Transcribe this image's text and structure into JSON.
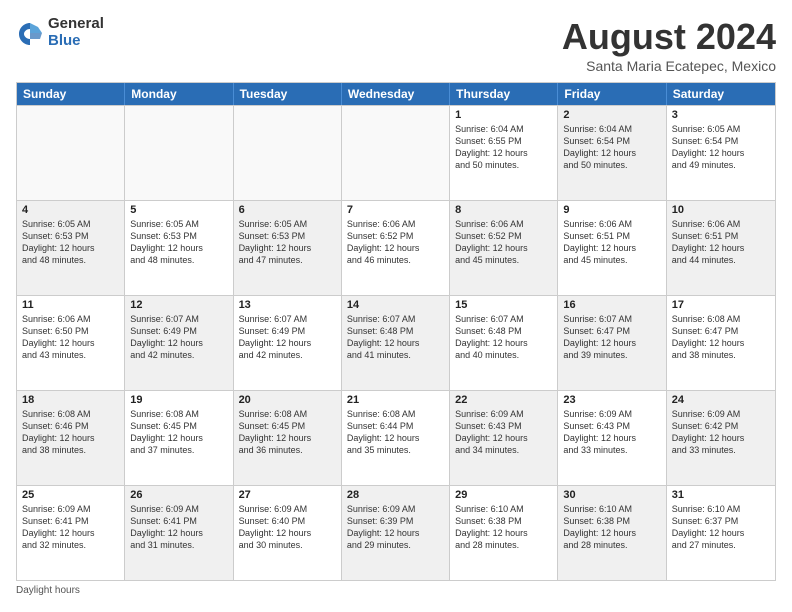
{
  "header": {
    "logo_general": "General",
    "logo_blue": "Blue",
    "title": "August 2024",
    "location": "Santa Maria Ecatepec, Mexico"
  },
  "days_of_week": [
    "Sunday",
    "Monday",
    "Tuesday",
    "Wednesday",
    "Thursday",
    "Friday",
    "Saturday"
  ],
  "footer": {
    "note": "Daylight hours"
  },
  "weeks": [
    [
      {
        "day": "",
        "info": "",
        "empty": true
      },
      {
        "day": "",
        "info": "",
        "empty": true
      },
      {
        "day": "",
        "info": "",
        "empty": true
      },
      {
        "day": "",
        "info": "",
        "empty": true
      },
      {
        "day": "1",
        "info": "Sunrise: 6:04 AM\nSunset: 6:55 PM\nDaylight: 12 hours\nand 50 minutes."
      },
      {
        "day": "2",
        "info": "Sunrise: 6:04 AM\nSunset: 6:54 PM\nDaylight: 12 hours\nand 50 minutes.",
        "shaded": true
      },
      {
        "day": "3",
        "info": "Sunrise: 6:05 AM\nSunset: 6:54 PM\nDaylight: 12 hours\nand 49 minutes."
      }
    ],
    [
      {
        "day": "4",
        "info": "Sunrise: 6:05 AM\nSunset: 6:53 PM\nDaylight: 12 hours\nand 48 minutes.",
        "shaded": true
      },
      {
        "day": "5",
        "info": "Sunrise: 6:05 AM\nSunset: 6:53 PM\nDaylight: 12 hours\nand 48 minutes."
      },
      {
        "day": "6",
        "info": "Sunrise: 6:05 AM\nSunset: 6:53 PM\nDaylight: 12 hours\nand 47 minutes.",
        "shaded": true
      },
      {
        "day": "7",
        "info": "Sunrise: 6:06 AM\nSunset: 6:52 PM\nDaylight: 12 hours\nand 46 minutes."
      },
      {
        "day": "8",
        "info": "Sunrise: 6:06 AM\nSunset: 6:52 PM\nDaylight: 12 hours\nand 45 minutes.",
        "shaded": true
      },
      {
        "day": "9",
        "info": "Sunrise: 6:06 AM\nSunset: 6:51 PM\nDaylight: 12 hours\nand 45 minutes."
      },
      {
        "day": "10",
        "info": "Sunrise: 6:06 AM\nSunset: 6:51 PM\nDaylight: 12 hours\nand 44 minutes.",
        "shaded": true
      }
    ],
    [
      {
        "day": "11",
        "info": "Sunrise: 6:06 AM\nSunset: 6:50 PM\nDaylight: 12 hours\nand 43 minutes."
      },
      {
        "day": "12",
        "info": "Sunrise: 6:07 AM\nSunset: 6:49 PM\nDaylight: 12 hours\nand 42 minutes.",
        "shaded": true
      },
      {
        "day": "13",
        "info": "Sunrise: 6:07 AM\nSunset: 6:49 PM\nDaylight: 12 hours\nand 42 minutes."
      },
      {
        "day": "14",
        "info": "Sunrise: 6:07 AM\nSunset: 6:48 PM\nDaylight: 12 hours\nand 41 minutes.",
        "shaded": true
      },
      {
        "day": "15",
        "info": "Sunrise: 6:07 AM\nSunset: 6:48 PM\nDaylight: 12 hours\nand 40 minutes."
      },
      {
        "day": "16",
        "info": "Sunrise: 6:07 AM\nSunset: 6:47 PM\nDaylight: 12 hours\nand 39 minutes.",
        "shaded": true
      },
      {
        "day": "17",
        "info": "Sunrise: 6:08 AM\nSunset: 6:47 PM\nDaylight: 12 hours\nand 38 minutes."
      }
    ],
    [
      {
        "day": "18",
        "info": "Sunrise: 6:08 AM\nSunset: 6:46 PM\nDaylight: 12 hours\nand 38 minutes.",
        "shaded": true
      },
      {
        "day": "19",
        "info": "Sunrise: 6:08 AM\nSunset: 6:45 PM\nDaylight: 12 hours\nand 37 minutes."
      },
      {
        "day": "20",
        "info": "Sunrise: 6:08 AM\nSunset: 6:45 PM\nDaylight: 12 hours\nand 36 minutes.",
        "shaded": true
      },
      {
        "day": "21",
        "info": "Sunrise: 6:08 AM\nSunset: 6:44 PM\nDaylight: 12 hours\nand 35 minutes."
      },
      {
        "day": "22",
        "info": "Sunrise: 6:09 AM\nSunset: 6:43 PM\nDaylight: 12 hours\nand 34 minutes.",
        "shaded": true
      },
      {
        "day": "23",
        "info": "Sunrise: 6:09 AM\nSunset: 6:43 PM\nDaylight: 12 hours\nand 33 minutes."
      },
      {
        "day": "24",
        "info": "Sunrise: 6:09 AM\nSunset: 6:42 PM\nDaylight: 12 hours\nand 33 minutes.",
        "shaded": true
      }
    ],
    [
      {
        "day": "25",
        "info": "Sunrise: 6:09 AM\nSunset: 6:41 PM\nDaylight: 12 hours\nand 32 minutes."
      },
      {
        "day": "26",
        "info": "Sunrise: 6:09 AM\nSunset: 6:41 PM\nDaylight: 12 hours\nand 31 minutes.",
        "shaded": true
      },
      {
        "day": "27",
        "info": "Sunrise: 6:09 AM\nSunset: 6:40 PM\nDaylight: 12 hours\nand 30 minutes."
      },
      {
        "day": "28",
        "info": "Sunrise: 6:09 AM\nSunset: 6:39 PM\nDaylight: 12 hours\nand 29 minutes.",
        "shaded": true
      },
      {
        "day": "29",
        "info": "Sunrise: 6:10 AM\nSunset: 6:38 PM\nDaylight: 12 hours\nand 28 minutes."
      },
      {
        "day": "30",
        "info": "Sunrise: 6:10 AM\nSunset: 6:38 PM\nDaylight: 12 hours\nand 28 minutes.",
        "shaded": true
      },
      {
        "day": "31",
        "info": "Sunrise: 6:10 AM\nSunset: 6:37 PM\nDaylight: 12 hours\nand 27 minutes."
      }
    ]
  ]
}
